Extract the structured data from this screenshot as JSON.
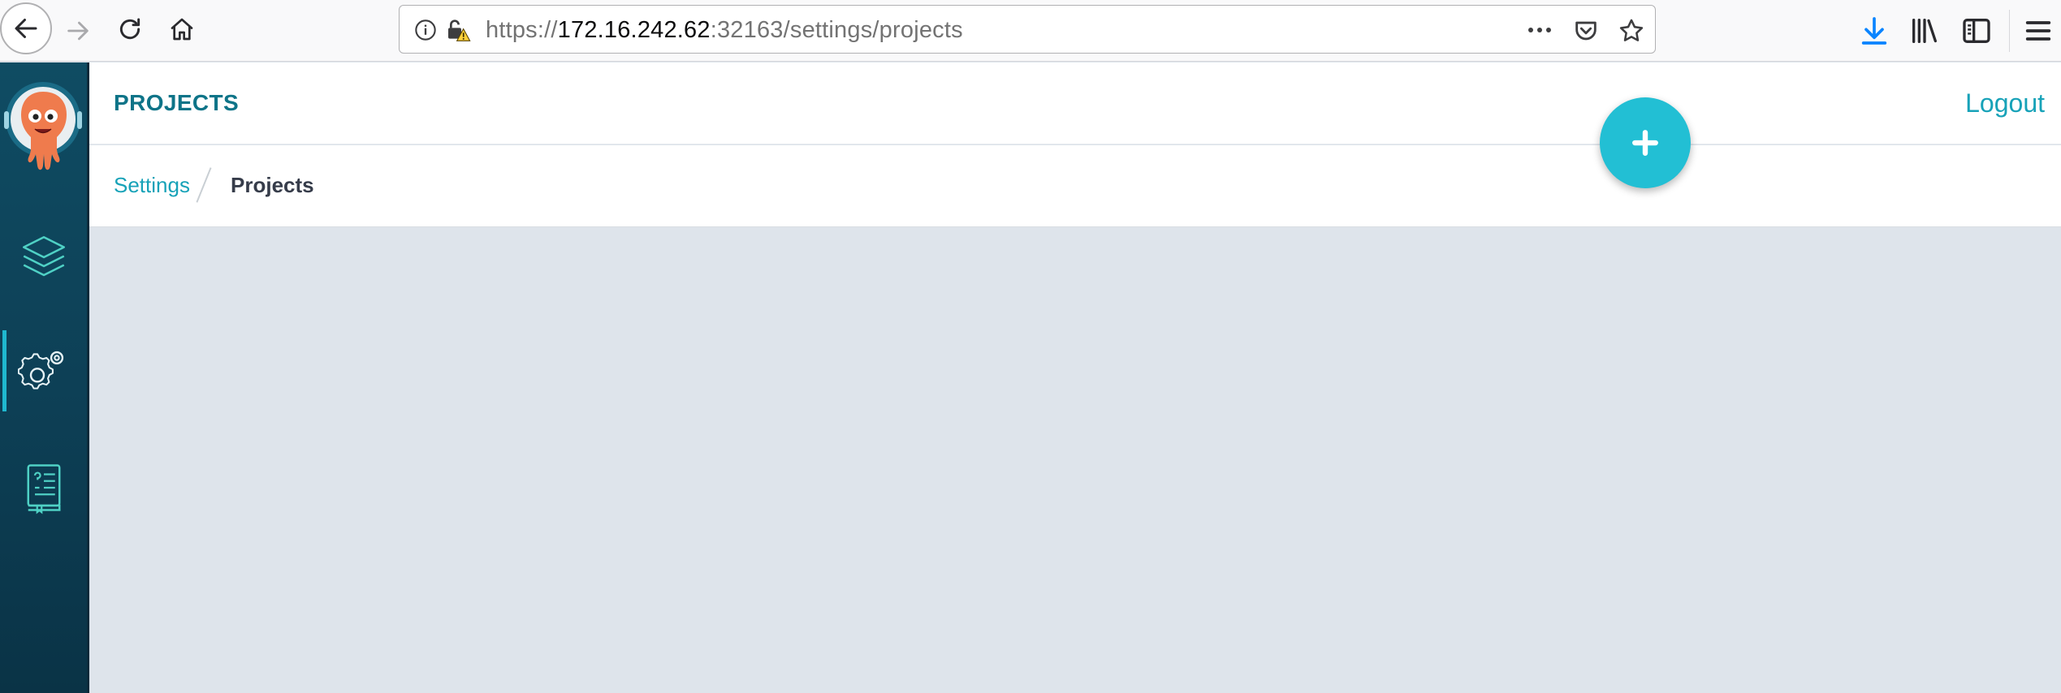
{
  "browser": {
    "url_prefix": "https://",
    "url_host": "172.16.242.62",
    "url_rest": ":32163/settings/projects"
  },
  "app": {
    "page_title": "PROJECTS",
    "logout_label": "Logout",
    "add_button_label": "+",
    "breadcrumb": {
      "parent": "Settings",
      "current": "Projects"
    },
    "sidebar": {
      "items": [
        {
          "icon": "layers-icon"
        },
        {
          "icon": "gear-icon",
          "active": true
        },
        {
          "icon": "help-book-icon"
        }
      ]
    },
    "colors": {
      "accent": "#17a2b8",
      "fab": "#22bfd4",
      "sidebar": "#0f4c63",
      "title": "#0e7488",
      "content_bg": "#dee4eb"
    }
  }
}
